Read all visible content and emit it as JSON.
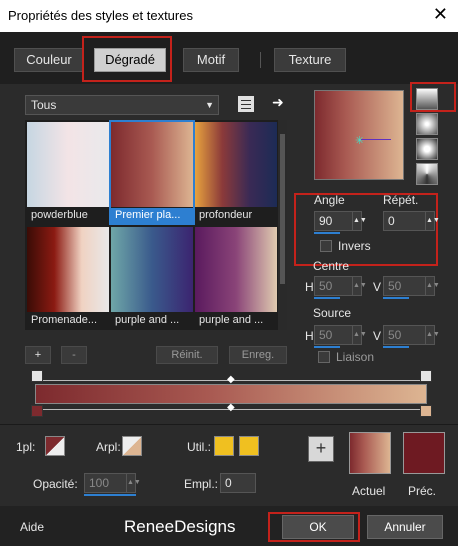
{
  "window": {
    "title": "Propriétés des styles et textures",
    "close_glyph": "✕"
  },
  "tabs": [
    {
      "label": "Couleur"
    },
    {
      "label": "Dégradé"
    },
    {
      "label": "Motif"
    },
    {
      "label": "Texture"
    }
  ],
  "library": {
    "filter_value": "Tous",
    "items": [
      {
        "label": "powderblue",
        "gradient": [
          "#c6d6e2",
          "#f3e4e6",
          "#e9e9ec"
        ]
      },
      {
        "label": "Premier pla...",
        "gradient": [
          "#7d2a2e",
          "#a95a52",
          "#ddb592"
        ]
      },
      {
        "label": "profondeur",
        "gradient": [
          "#e7a23e",
          "#8b3a3a",
          "#3a2a55",
          "#1c2b55"
        ]
      },
      {
        "label": "Promenade...",
        "gradient": [
          "#3a0c06",
          "#8b1a12",
          "#f0d2c2",
          "#e8e8e8"
        ]
      },
      {
        "label": "purple and ...",
        "gradient": [
          "#6fa7a8",
          "#3a5a8c",
          "#3b2470"
        ]
      },
      {
        "label": "purple and ...",
        "gradient": [
          "#5a1a5e",
          "#8a4478",
          "#e0cbb0"
        ]
      }
    ]
  },
  "settings": {
    "angle_label": "Angle",
    "angle_value": "90",
    "repeat_label": "Répét.",
    "repeat_value": "0",
    "invert_label": "Invers",
    "center_label": "Centre",
    "center_h_label": "H",
    "center_h_value": "50",
    "center_v_label": "V",
    "center_v_value": "50",
    "source_label": "Source",
    "source_h_label": "H",
    "source_h_value": "50",
    "source_v_label": "V",
    "source_v_value": "50",
    "link_label": "Liaison"
  },
  "editor": {
    "add_label": "+",
    "remove_label": "-",
    "reset_label": "Réinit.",
    "save_label": "Enreg.",
    "colors": [
      "#7d2a2e",
      "#a95a52",
      "#ddb592"
    ]
  },
  "bottom": {
    "fg_label": "1pl:",
    "bg_label": "Arpl:",
    "user_label": "Util.:",
    "opacity_label": "Opacité:",
    "opacity_value": "100",
    "location_label": "Empl.:",
    "location_value": "0",
    "current_label": "Actuel",
    "previous_label": "Préc.",
    "add_swatch_label": "+",
    "fg_color": "#7d2a2e",
    "bg_color": "#ddb592",
    "user_color": "#f0c020",
    "previous_color": "#6e1a22"
  },
  "footer": {
    "help_label": "Aide",
    "watermark": "ReneeDesigns",
    "ok_label": "OK",
    "cancel_label": "Annuler"
  }
}
